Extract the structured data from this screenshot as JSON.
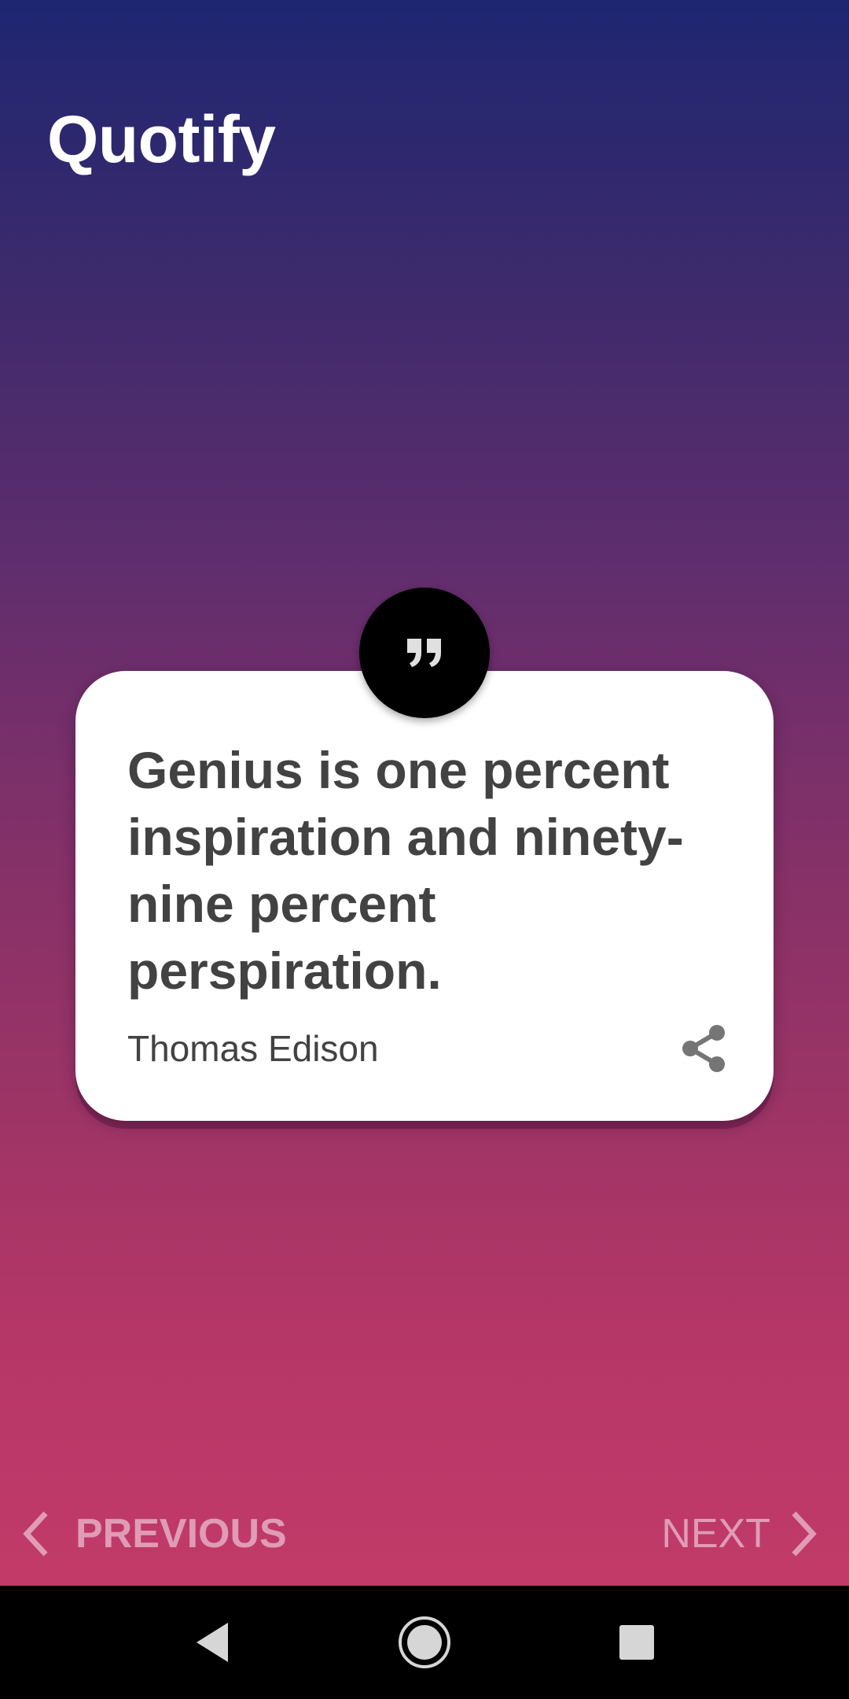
{
  "app": {
    "title": "Quotify"
  },
  "quote": {
    "text": "Genius is one percent inspiration and ninety-nine percent perspiration.",
    "author": "Thomas Edison",
    "badge_icon": "quote-icon",
    "share_icon": "share-icon"
  },
  "navigation": {
    "previous_label": "PREVIOUS",
    "next_label": "NEXT",
    "previous_icon": "chevron-left-icon",
    "next_icon": "chevron-right-icon"
  },
  "system_nav": {
    "back_icon": "back-icon",
    "home_icon": "home-icon",
    "recents_icon": "recents-icon"
  },
  "colors": {
    "gradient_top": "#1e2671",
    "gradient_bottom": "#c23a68",
    "card": "#ffffff",
    "text": "#424242"
  }
}
